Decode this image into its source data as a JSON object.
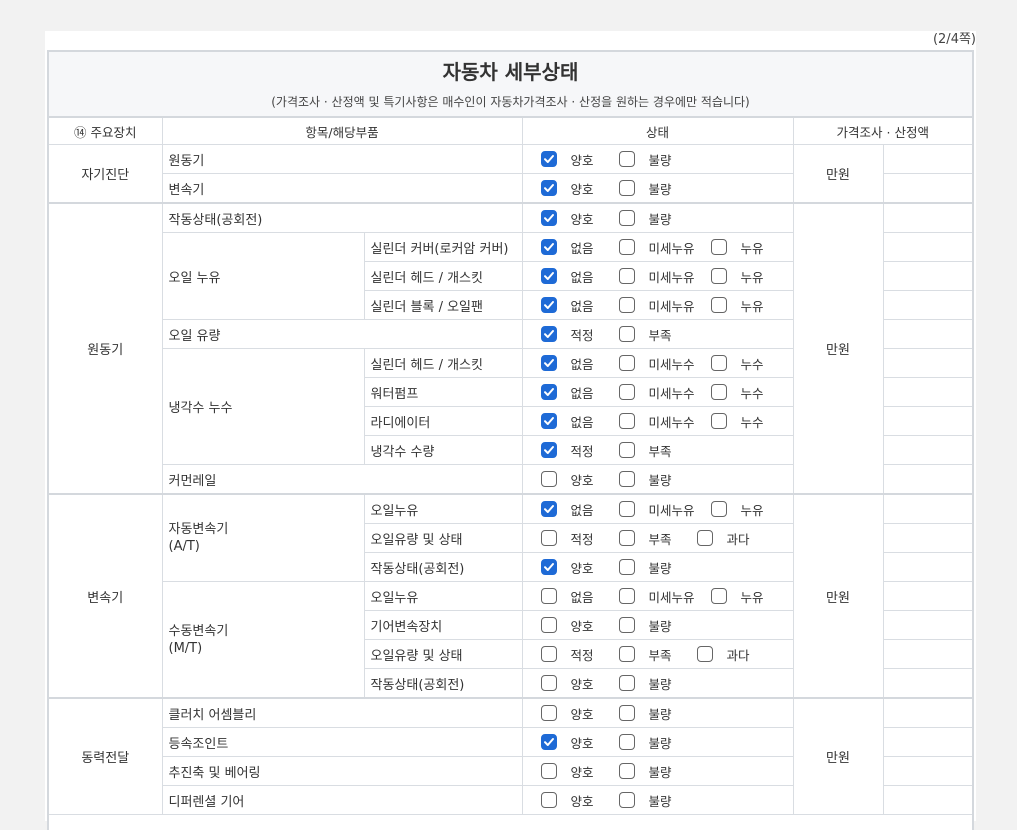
{
  "page_number": "(2/4쪽)",
  "title": "자동차 세부상태",
  "subtitle": "(가격조사 · 산정액 및 특기사항은 매수인이 자동차가격조사 · 산정을 원하는 경우에만 적습니다)",
  "headers": {
    "main_device": "⑭ 주요장치",
    "items": "항목/해당부품",
    "status": "상태",
    "price": "가격조사 · 산정액"
  },
  "unit": "만원",
  "sections": {
    "diag": "자기진단",
    "engine": "원동기",
    "trans": "변속기",
    "power": "동력전달"
  },
  "groups": {
    "oil_leak": "오일 누유",
    "coolant_leak": "냉각수 누수",
    "auto_trans": "자동변속기\n(A/T)",
    "manual_trans": "수동변속기\n(M/T)"
  },
  "rows": [
    {
      "item": "원동기",
      "opts": [
        [
          "양호",
          true
        ],
        [
          "불량",
          false
        ]
      ]
    },
    {
      "item": "변속기",
      "opts": [
        [
          "양호",
          true
        ],
        [
          "불량",
          false
        ]
      ]
    },
    {
      "item": "작동상태(공회전)",
      "opts": [
        [
          "양호",
          true
        ],
        [
          "불량",
          false
        ]
      ]
    },
    {
      "item": "실린더 커버(로커암 커버)",
      "opts": [
        [
          "없음",
          true
        ],
        [
          "미세누유",
          false
        ],
        [
          "누유",
          false
        ]
      ]
    },
    {
      "item": "실린더 헤드 / 개스킷",
      "opts": [
        [
          "없음",
          true
        ],
        [
          "미세누유",
          false
        ],
        [
          "누유",
          false
        ]
      ]
    },
    {
      "item": "실린더 블록 / 오일팬",
      "opts": [
        [
          "없음",
          true
        ],
        [
          "미세누유",
          false
        ],
        [
          "누유",
          false
        ]
      ]
    },
    {
      "item": "오일 유량",
      "opts": [
        [
          "적정",
          true
        ],
        [
          "부족",
          false
        ]
      ]
    },
    {
      "item": "실린더 헤드 / 개스킷",
      "opts": [
        [
          "없음",
          true
        ],
        [
          "미세누수",
          false
        ],
        [
          "누수",
          false
        ]
      ]
    },
    {
      "item": "워터펌프",
      "opts": [
        [
          "없음",
          true
        ],
        [
          "미세누수",
          false
        ],
        [
          "누수",
          false
        ]
      ]
    },
    {
      "item": "라디에이터",
      "opts": [
        [
          "없음",
          true
        ],
        [
          "미세누수",
          false
        ],
        [
          "누수",
          false
        ]
      ]
    },
    {
      "item": "냉각수 수량",
      "opts": [
        [
          "적정",
          true
        ],
        [
          "부족",
          false
        ]
      ]
    },
    {
      "item": "커먼레일",
      "opts": [
        [
          "양호",
          false
        ],
        [
          "불량",
          false
        ]
      ]
    },
    {
      "item": "오일누유",
      "opts": [
        [
          "없음",
          true
        ],
        [
          "미세누유",
          false
        ],
        [
          "누유",
          false
        ]
      ]
    },
    {
      "item": "오일유량 및 상태",
      "opts": [
        [
          "적정",
          false
        ],
        [
          "부족",
          false
        ],
        [
          "과다",
          false
        ]
      ]
    },
    {
      "item": "작동상태(공회전)",
      "opts": [
        [
          "양호",
          true
        ],
        [
          "불량",
          false
        ]
      ]
    },
    {
      "item": "오일누유",
      "opts": [
        [
          "없음",
          false
        ],
        [
          "미세누유",
          false
        ],
        [
          "누유",
          false
        ]
      ]
    },
    {
      "item": "기어변속장치",
      "opts": [
        [
          "양호",
          false
        ],
        [
          "불량",
          false
        ]
      ]
    },
    {
      "item": "오일유량 및 상태",
      "opts": [
        [
          "적정",
          false
        ],
        [
          "부족",
          false
        ],
        [
          "과다",
          false
        ]
      ]
    },
    {
      "item": "작동상태(공회전)",
      "opts": [
        [
          "양호",
          false
        ],
        [
          "불량",
          false
        ]
      ]
    },
    {
      "item": "클러치 어셈블리",
      "opts": [
        [
          "양호",
          false
        ],
        [
          "불량",
          false
        ]
      ]
    },
    {
      "item": "등속조인트",
      "opts": [
        [
          "양호",
          true
        ],
        [
          "불량",
          false
        ]
      ]
    },
    {
      "item": "추진축 및 베어링",
      "opts": [
        [
          "양호",
          false
        ],
        [
          "불량",
          false
        ]
      ]
    },
    {
      "item": "디퍼렌셜 기어",
      "opts": [
        [
          "양호",
          false
        ],
        [
          "불량",
          false
        ]
      ]
    }
  ],
  "colors": {
    "check": "#1e6ad6",
    "border": "#d9dde2",
    "header_bg": "#f6f7f9"
  }
}
